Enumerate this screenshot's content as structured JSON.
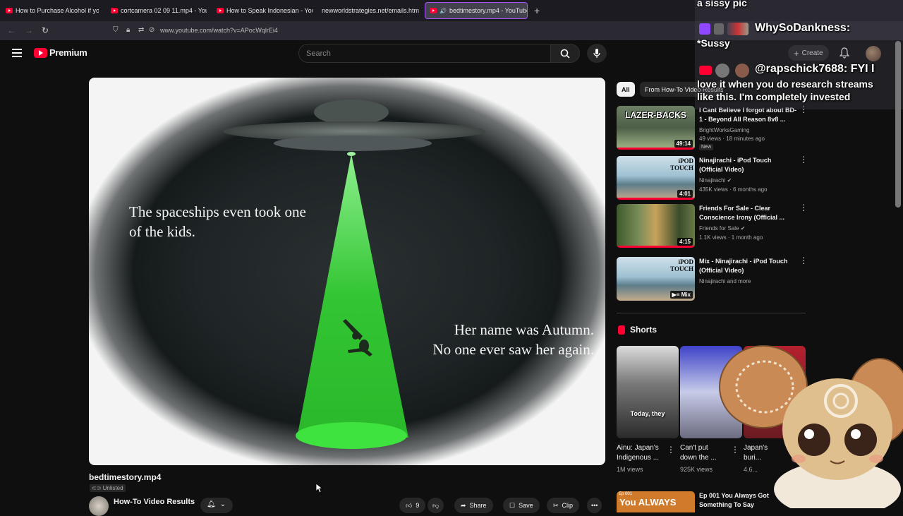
{
  "browser": {
    "tabs": [
      {
        "title": "How to Purchase Alcohol if you",
        "favicon": "youtube-icon"
      },
      {
        "title": "cortcamera 02 09 11.mp4 - You",
        "favicon": "youtube-icon"
      },
      {
        "title": "How to Speak Indonesian - You",
        "favicon": "youtube-icon"
      },
      {
        "title": "newworldstrategies.net/emails.htm",
        "favicon": "none"
      },
      {
        "title": "bedtimestory.mp4 - YouTube",
        "favicon": "youtube-icon",
        "active": true
      }
    ],
    "url": "www.youtube.com/watch?v=APocWqlrEi4"
  },
  "header": {
    "logo_text": "Premium",
    "search_placeholder": "Search",
    "create_label": "Create"
  },
  "video": {
    "subtitle_1": "The spaceships even took one of the kids.",
    "subtitle_2_line1": "Her name was Autumn.",
    "subtitle_2_line2": "No one ever saw her again.",
    "title": "bedtimestory.mp4",
    "visibility": "Unlisted",
    "channel": "How-To Video Results",
    "like_count": "9",
    "share_label": "Share",
    "save_label": "Save",
    "clip_label": "Clip"
  },
  "chips": {
    "all": "All",
    "from_channel": "From How-To Video Results"
  },
  "recommendations": [
    {
      "thumb_text": "LAZER-BACKS",
      "duration": "49:14",
      "title": "I Cant Believe I forgot about BD-1 - Beyond All Reason 8v8 ...",
      "channel": "BrightWorksGaming",
      "views": "49 views · 18 minutes ago",
      "badge": "New"
    },
    {
      "thumb_text": "iPOD TOUCH",
      "duration": "4:01",
      "title": "Ninajirachi - iPod Touch (Official Video)",
      "channel": "Ninajirachi",
      "views": "435K views · 6 months ago"
    },
    {
      "duration": "4:15",
      "title": "Friends For Sale - Clear Conscience Irony (Official ...",
      "channel": "Friends for Sale",
      "views": "1.1K views · 1 month ago"
    },
    {
      "thumb_text": "iPOD TOUCH",
      "duration": "Mix",
      "title": "Mix - Ninajirachi - iPod Touch (Official Video)",
      "channel": "Ninajirachi and more"
    }
  ],
  "shorts": {
    "heading": "Shorts",
    "items": [
      {
        "caption": "Today, they",
        "title_l1": "Ainu: Japan's",
        "title_l2": "Indigenous ...",
        "views": "1M views"
      },
      {
        "title_l1": "Can't put",
        "title_l2": "down the ...",
        "views": "925K views"
      },
      {
        "title_l1": "Japan's",
        "title_l2": "buri...",
        "views": "4.6..."
      }
    ]
  },
  "next_video": {
    "thumb_label": "Ep 001",
    "thumb_text": "You ALWAYS",
    "title_l1": "Ep 001  You Always Got",
    "title_l2": "Something To Say"
  },
  "chat_overlay": {
    "line0": "a sissy pic",
    "user1": "WhySoDankness:",
    "msg1": "*Sussy",
    "user2": "@rapschick7688:",
    "msg2_a": "FYI I",
    "msg2_b": "love it when you do research streams",
    "msg2_c": "like this. I'm completely invested"
  },
  "colors": {
    "accent": "#ff0033",
    "tab_active_border": "#a855f7",
    "beam": "#2fd12f"
  }
}
